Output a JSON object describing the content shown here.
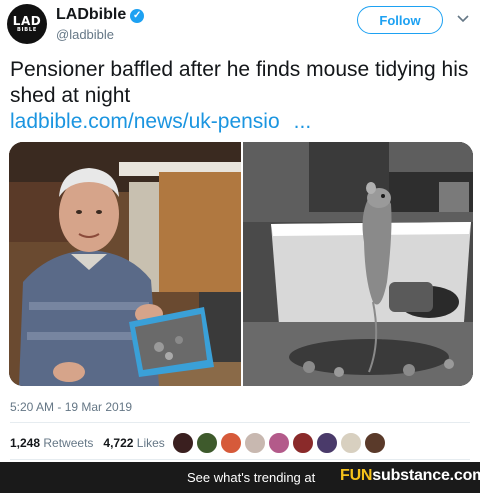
{
  "account": {
    "avatar_line1": "LAD",
    "avatar_line2": "BIBLE",
    "name": "LADbible",
    "handle": "@ladbible",
    "verified_glyph": "✓"
  },
  "follow_label": "Follow",
  "menu_icon": "chevron-down-icon",
  "tweet": {
    "text": "Pensioner baffled after he finds mouse tidying his shed at night",
    "link": "ladbible.com/news/uk-pensio",
    "ellipsis": "..."
  },
  "media": {
    "left_photo": "man-holding-box-of-bolts",
    "right_photo": "mouse-standing-in-bucket-night-camera"
  },
  "timestamp": "5:20 AM - 19 Mar 2019",
  "stats": {
    "retweets_count": "1,248",
    "retweets_label": "Retweets",
    "likes_count": "4,722",
    "likes_label": "Likes"
  },
  "likers": [
    {
      "color": "#3a1f1f"
    },
    {
      "color": "#3e5a2c"
    },
    {
      "color": "#d65a3a"
    },
    {
      "color": "#c8b8b0"
    },
    {
      "color": "#b35a8a"
    },
    {
      "color": "#8a2a2a"
    },
    {
      "color": "#4a3a6a"
    },
    {
      "color": "#d8d0c0"
    },
    {
      "color": "#5a3a2a"
    }
  ],
  "footer": {
    "text": "See what's trending at",
    "brand_fun": "FUN",
    "brand_rest": "substance.com"
  },
  "colors": {
    "accent": "#1da1f2",
    "link": "#1b95e0",
    "footer_bg": "#1a1a1a",
    "brand_yellow": "#f6c21a"
  }
}
